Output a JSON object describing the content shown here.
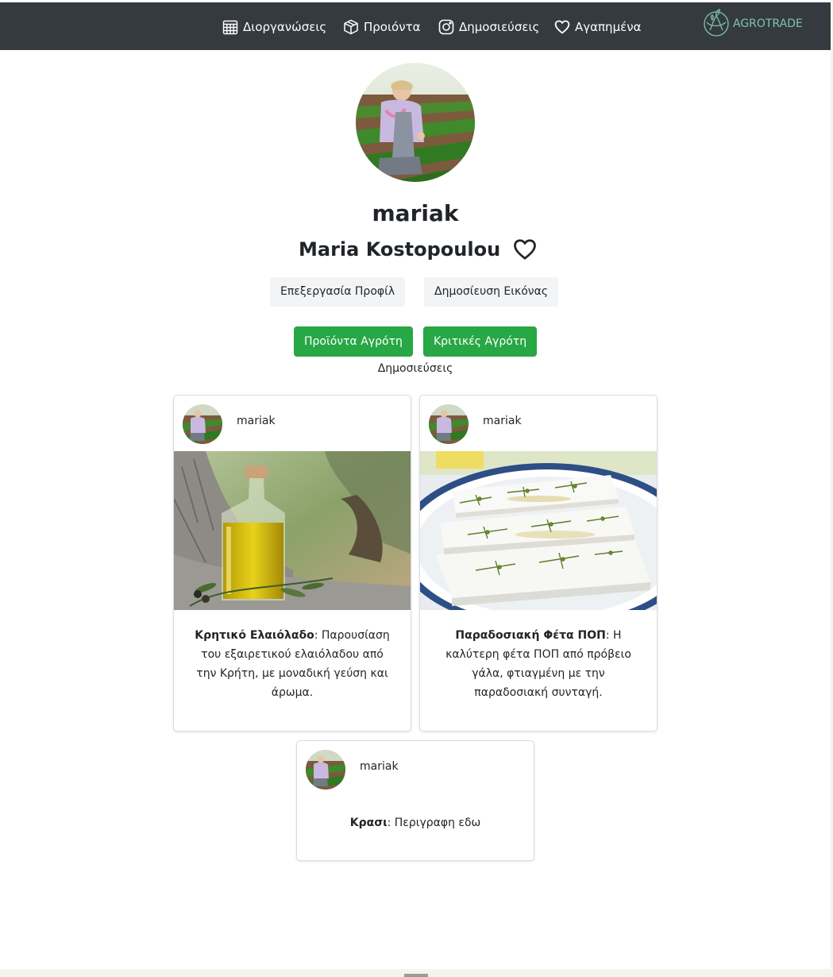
{
  "nav": {
    "items": [
      {
        "label": "Διοργανώσεις",
        "icon": "calendar-icon"
      },
      {
        "label": "Προιόντα",
        "icon": "box-icon"
      },
      {
        "label": "Δημοσιεύσεις",
        "icon": "instagram-icon"
      },
      {
        "label": "Αγαπημένα",
        "icon": "heart-icon"
      }
    ],
    "brand": "AGROTRADE",
    "brand_icon": "globe-leaf-icon"
  },
  "profile": {
    "username": "mariak",
    "full_name": "Maria Kostopoulou",
    "favorite_icon": "heart-outline-icon",
    "edit_profile": "Επεξεργασία Προφίλ",
    "publish_image": "Δημοσίευση Εικόνας",
    "farmer_products": "Προϊόντα Αγρότη",
    "farmer_reviews": "Κριτικές Αγρότη",
    "posts_label": "Δημοσιεύσεις"
  },
  "posts": [
    {
      "user": "mariak",
      "title": "Κρητικό Ελαιόλαδο",
      "text": ": Παρουσίαση του εξαιρετικού ελαιόλαδου από την Κρήτη, με μοναδική γεύση και άρωμα."
    },
    {
      "user": "mariak",
      "title": "Παραδοσιακή Φέτα ΠΟΠ",
      "text": ": Η καλύτερη φέτα ΠΟΠ από πρόβειο γάλα, φτιαγμένη με την παραδοσιακή συνταγή."
    },
    {
      "user": "mariak",
      "title": "Κρασι",
      "text": ": Περιγραφη εδω"
    }
  ],
  "colors": {
    "navbar": "#343a40",
    "brand": "#7fc5a6",
    "green_button": "#28a745",
    "light_button": "#f3f4f6"
  }
}
